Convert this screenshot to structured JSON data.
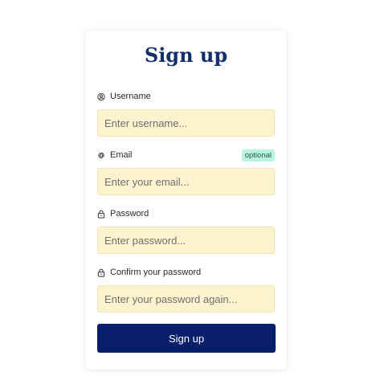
{
  "form": {
    "title": "Sign up",
    "fields": [
      {
        "icon": "user-circle-icon",
        "label": "Username",
        "placeholder": "Enter username...",
        "value": ""
      },
      {
        "icon": "at-icon",
        "label": "Email",
        "placeholder": "Enter your email...",
        "value": "",
        "badge": "optional"
      },
      {
        "icon": "lock-icon",
        "label": "Password",
        "placeholder": "Enter password...",
        "value": ""
      },
      {
        "icon": "lock-icon",
        "label": "Confirm your password",
        "placeholder": "Enter your password again...",
        "value": ""
      }
    ],
    "submit_label": "Sign up"
  },
  "colors": {
    "title": "#142d6b",
    "input_background": "#fdf3cf",
    "input_border": "#f1e4b3",
    "button_background": "#0a1f6c",
    "badge_background": "#b9f3dd"
  }
}
